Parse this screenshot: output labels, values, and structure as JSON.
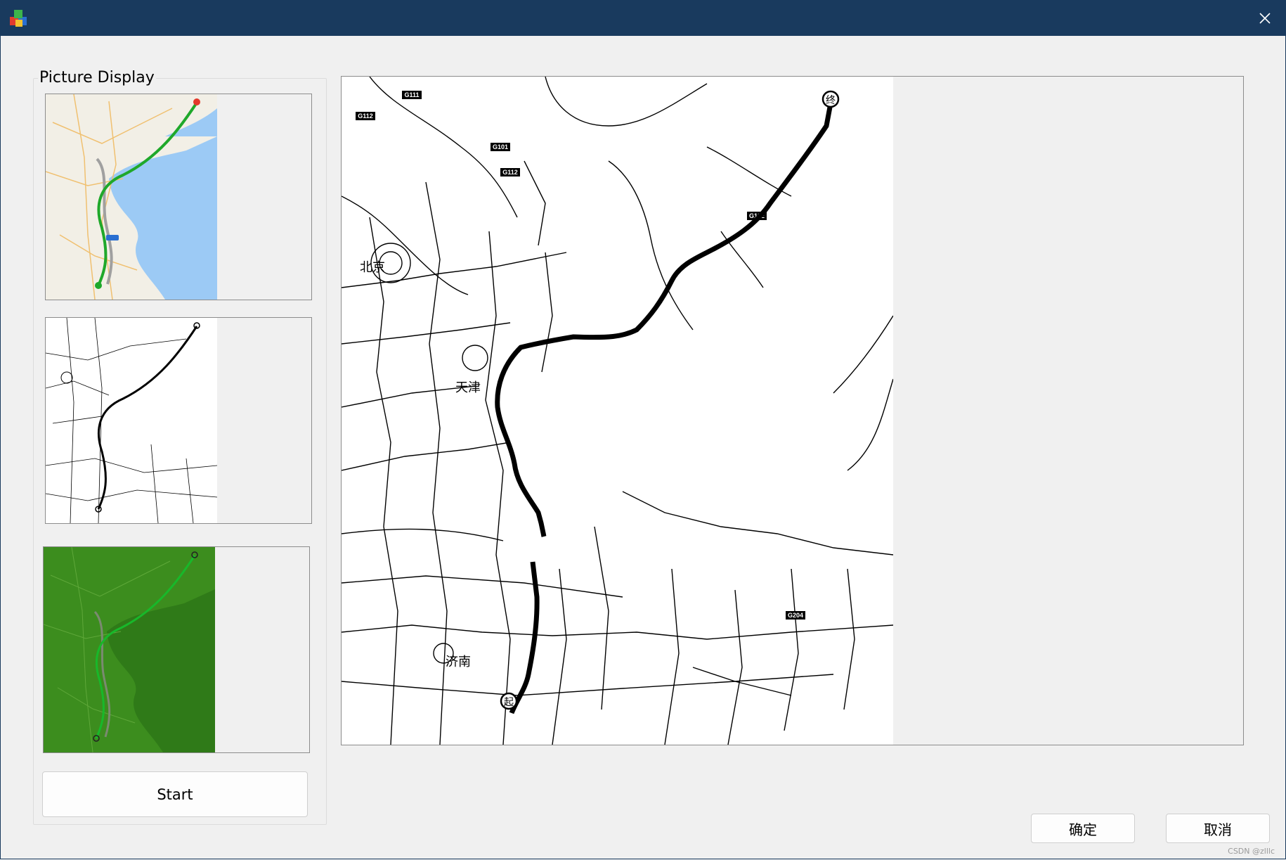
{
  "window": {
    "title": "",
    "titlebar_color": "#193a5e",
    "icons": {
      "app": "app-cube-icon",
      "close": "close-icon"
    }
  },
  "group": {
    "title": "Picture Display"
  },
  "thumbnails": [
    {
      "name": "original-map-thumbnail",
      "style": "color road map with green route"
    },
    {
      "name": "binary-map-thumbnail",
      "style": "black and white road map"
    },
    {
      "name": "green-tinted-map-thumbnail",
      "style": "green tinted map"
    }
  ],
  "main_view": {
    "labels": {
      "beijing": "北京",
      "tianjin": "天津",
      "jinan": "济南",
      "start_marker": "起",
      "end_marker": "终",
      "road_g111": "G111",
      "road_g112_a": "G112",
      "road_g101": "G101",
      "road_g112_b": "G112",
      "road_g102": "G102",
      "road_g204": "G204"
    }
  },
  "buttons": {
    "start": "Start",
    "ok": "确定",
    "cancel": "取消"
  },
  "watermark": "CSDN @zlllc"
}
